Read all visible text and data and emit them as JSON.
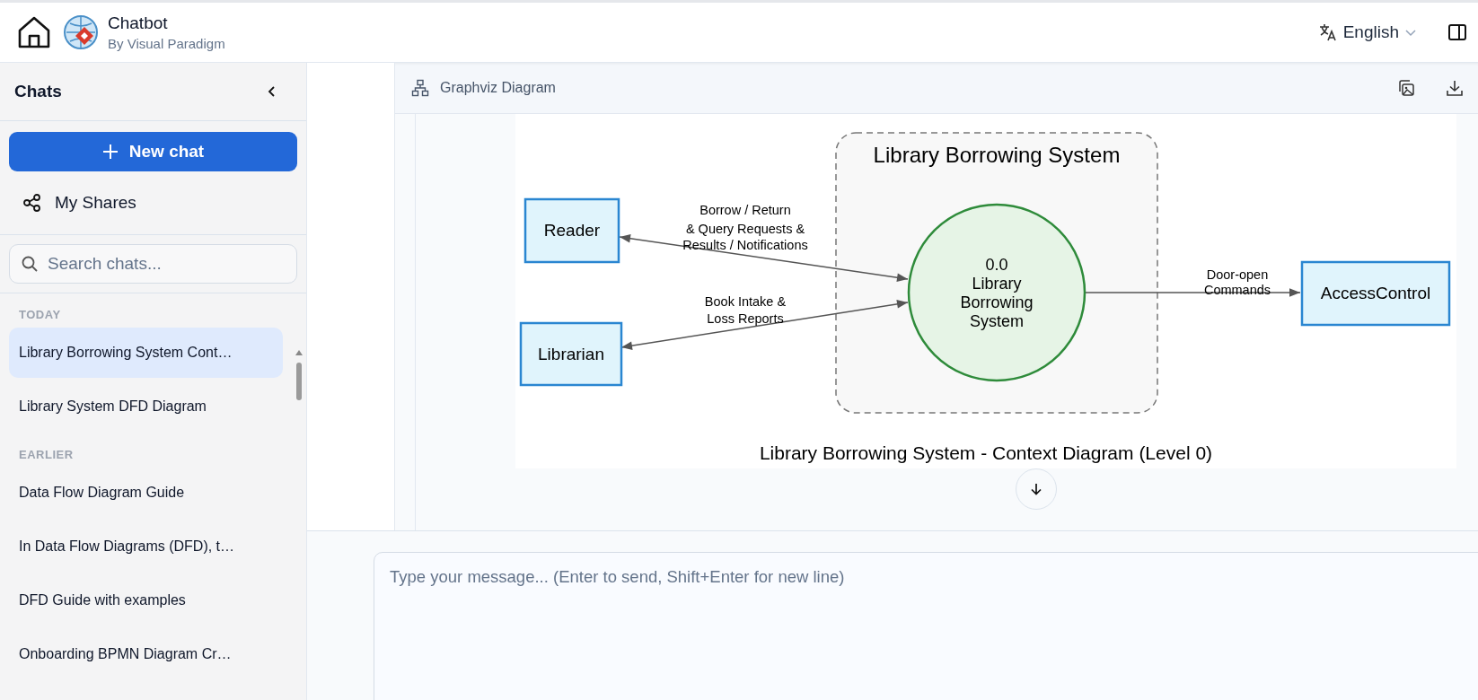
{
  "header": {
    "title": "Chatbot",
    "subtitle": "By Visual Paradigm",
    "language": "English"
  },
  "sidebar": {
    "title": "Chats",
    "new_chat": "New chat",
    "my_shares": "My Shares",
    "search": {
      "placeholder": "Search chats..."
    },
    "groups": [
      {
        "label": "TODAY",
        "items": [
          {
            "title": "Library Borrowing System Cont…",
            "selected": true
          },
          {
            "title": "Library System DFD Diagram",
            "selected": false
          }
        ]
      },
      {
        "label": "EARLIER",
        "items": [
          {
            "title": "Data Flow Diagram Guide",
            "selected": false
          },
          {
            "title": "In Data Flow Diagrams (DFD), t…",
            "selected": false
          },
          {
            "title": "DFD Guide with examples",
            "selected": false
          },
          {
            "title": "Onboarding BPMN Diagram Cr…",
            "selected": false
          }
        ]
      }
    ]
  },
  "code_block": {
    "title": "Graphviz Diagram",
    "diagram": {
      "cluster_title": "Library Borrowing System",
      "nodes": [
        {
          "kind": "entity",
          "lines": [
            "Reader"
          ]
        },
        {
          "kind": "entity",
          "lines": [
            "Librarian"
          ]
        },
        {
          "kind": "process",
          "lines": [
            "0.0",
            "Library",
            "Borrowing",
            "System"
          ]
        },
        {
          "kind": "entity",
          "lines": [
            "AccessControl"
          ]
        }
      ],
      "edges": [
        {
          "kind": "two-way",
          "lines": [
            "Borrow / Return",
            "& Query Requests &",
            "Results / Notifications"
          ]
        },
        {
          "kind": "two-way",
          "lines": [
            "Book Intake &",
            "Loss Reports"
          ]
        },
        {
          "kind": "one-way",
          "lines": [
            "Door-open",
            "Commands"
          ]
        }
      ],
      "caption": "Library Borrowing System - Context Diagram (Level 0)"
    }
  },
  "input": {
    "placeholder": "Type your message... (Enter to send, Shift+Enter for new line)"
  }
}
